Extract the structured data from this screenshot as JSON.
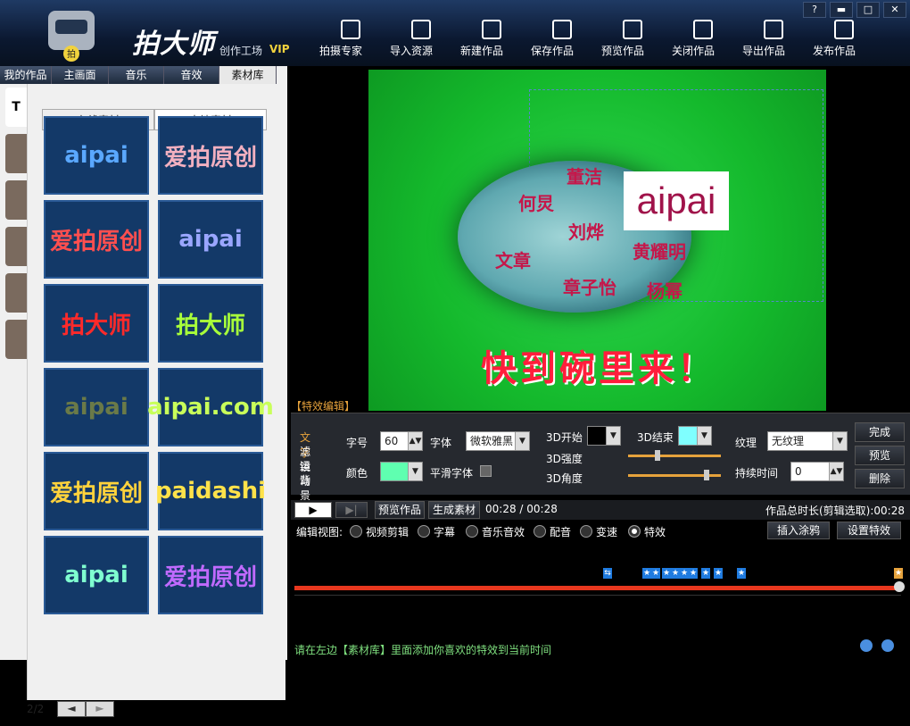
{
  "app": {
    "brand": "拍大师",
    "subtitle": "创作工场",
    "vip": "VIP"
  },
  "toolbar": [
    {
      "label": "拍摄专家",
      "icon": "camera-icon"
    },
    {
      "label": "导入资源",
      "icon": "import-icon"
    },
    {
      "label": "新建作品",
      "icon": "new-file-icon"
    },
    {
      "label": "保存作品",
      "icon": "save-icon"
    },
    {
      "label": "预览作品",
      "icon": "eye-icon"
    },
    {
      "label": "关闭作品",
      "icon": "close-file-icon"
    },
    {
      "label": "导出作品",
      "icon": "export-icon"
    },
    {
      "label": "发布作品",
      "icon": "upload-icon"
    }
  ],
  "window_controls": [
    "?",
    "▬",
    "□",
    "✕"
  ],
  "tabs": [
    "我的作品",
    "主画面",
    "音乐",
    "音效",
    "素材库"
  ],
  "side_tabs": [
    "T",
    "",
    "",
    "",
    "",
    ""
  ],
  "subtabs": [
    "在线素材",
    "本地素材"
  ],
  "tiles": [
    {
      "text": "aipai",
      "color": "#5aa8ff"
    },
    {
      "text": "爱拍原创",
      "color": "#f2b0c0"
    },
    {
      "text": "爱拍原创",
      "color": "#ff4f4f"
    },
    {
      "text": "aipai",
      "color": "#9aa6ff"
    },
    {
      "text": "拍大师",
      "color": "#ff2a2a"
    },
    {
      "text": "拍大师",
      "color": "#a8ff3a"
    },
    {
      "text": "aipai",
      "color": "#6a7a48"
    },
    {
      "text": "aipai.com",
      "color": "#c8ff5a"
    },
    {
      "text": "爱拍原创",
      "color": "#ffd23c"
    },
    {
      "text": "paidashi",
      "color": "#ffe24a"
    },
    {
      "text": "aipai",
      "color": "#7fffd0"
    },
    {
      "text": "爱拍原创",
      "color": "#c06aff"
    }
  ],
  "pager": {
    "text": "2/2",
    "prev": "◄",
    "next": "►"
  },
  "preview": {
    "overlay_text": "aipai",
    "names": [
      "董洁",
      "何炅",
      "刘烨",
      "文章",
      "黄耀明",
      "章子怡",
      "杨幂"
    ],
    "headline": "快到碗里来！"
  },
  "fx": {
    "label": "【特效编辑】",
    "categories": [
      "文字",
      "滤镜",
      "运动",
      "背景"
    ],
    "font_size_label": "字号",
    "font_size": "60",
    "font_label": "字体",
    "font_value": "微软雅黑",
    "color_label": "颜色",
    "color_value": "#5fffb0",
    "smooth_label": "平滑字体",
    "start3d_label": "3D开始",
    "start3d_color": "#000000",
    "end3d_label": "3D结束",
    "end3d_color": "#7fffff",
    "strength_label": "3D强度",
    "angle_label": "3D角度",
    "strength_value": 0.3,
    "angle_value": 0.85,
    "texture_label": "纹理",
    "texture_value": "无纹理",
    "duration_label": "持续时间",
    "duration_value": "0",
    "done": "完成",
    "preview": "预览",
    "delete": "删除"
  },
  "transport": {
    "play": "▶",
    "next": "▶|",
    "preview_btn": "预览作品",
    "gen_btn": "生成素材",
    "time": "00:28 / 00:28",
    "total": "作品总时长(剪辑选取):00:28"
  },
  "editview": {
    "label": "编辑视图:",
    "options": [
      "视频剪辑",
      "字幕",
      "音乐音效",
      "配音",
      "变速",
      "特效"
    ],
    "selected": 5,
    "insert_btn": "插入涂鸦",
    "settings_btn": "设置特效"
  },
  "status": "请在左边【素材库】里面添加你喜欢的特效到当前时间"
}
